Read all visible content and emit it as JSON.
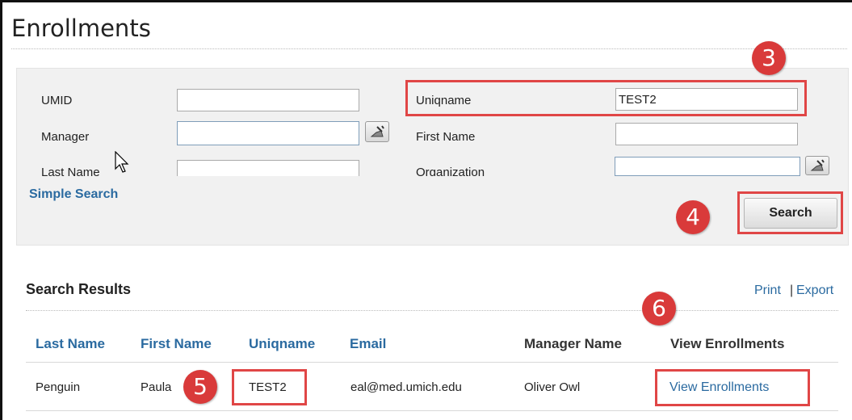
{
  "page": {
    "title": "Enrollments"
  },
  "search_form": {
    "umid_label": "UMID",
    "umid_value": "",
    "manager_label": "Manager",
    "manager_value": "",
    "last_name_label": "Last Name",
    "last_name_value": "",
    "uniqname_label": "Uniqname",
    "uniqname_value": "TEST2",
    "first_name_label": "First Name",
    "first_name_value": "",
    "organization_label": "Organization",
    "organization_value": "",
    "simple_search_label": "Simple Search",
    "search_button_label": "Search",
    "picker_icon": "person-picker-icon"
  },
  "results": {
    "title": "Search Results",
    "print_label": "Print",
    "separator": "|",
    "export_label": "Export",
    "columns": [
      "Last Name",
      "First Name",
      "Uniqname",
      "Email",
      "Manager Name",
      "View Enrollments"
    ],
    "rows": [
      {
        "last_name": "Penguin",
        "first_name": "Paula",
        "uniqname": "TEST2",
        "email": "eal@med.umich.edu",
        "manager_name": "Oliver Owl",
        "view_link": "View Enrollments"
      }
    ]
  },
  "annotations": {
    "step3": "3",
    "step4": "4",
    "step5": "5",
    "step6": "6",
    "color": "#d93a3a"
  },
  "colors": {
    "link": "#2a6aa0",
    "highlight": "#e04646",
    "panel_bg": "#f1f1f1"
  }
}
